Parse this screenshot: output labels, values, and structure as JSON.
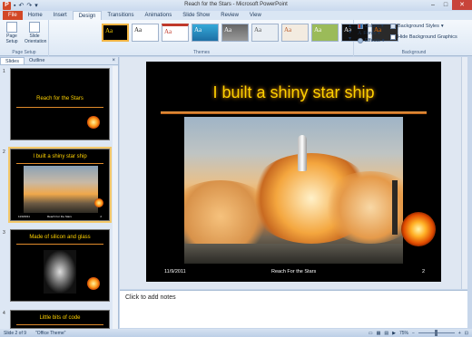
{
  "window": {
    "title": "Reach for the Stars - Microsoft PowerPoint"
  },
  "qat": {
    "save_icon": "save-icon",
    "undo_icon": "undo-icon",
    "redo_icon": "redo-icon"
  },
  "tabs": [
    "File",
    "Home",
    "Insert",
    "Design",
    "Transitions",
    "Animations",
    "Slide Show",
    "Review",
    "View"
  ],
  "active_tab": "Design",
  "ribbon": {
    "page_setup": {
      "page_setup_label": "Page Setup",
      "orientation_label": "Slide Orientation",
      "group_label": "Page Setup"
    },
    "themes": {
      "group_label": "Themes",
      "thumb_label": "Aa"
    },
    "theme_options": {
      "colors": "Colors",
      "fonts": "Fonts",
      "effects": "Effects"
    },
    "background": {
      "styles": "Background Styles",
      "hide": "Hide Background Graphics",
      "group_label": "Background"
    }
  },
  "panel": {
    "tabs": [
      "Slides",
      "Outline"
    ],
    "close": "×"
  },
  "slides": [
    {
      "num": "1",
      "title": "Reach for the Stars"
    },
    {
      "num": "2",
      "title": "I built a shiny star ship",
      "date": "11/9/2011",
      "footer": "Reach For the Stars",
      "page": "2"
    },
    {
      "num": "3",
      "title": "Made of silicon and glass"
    },
    {
      "num": "4",
      "title": "Little bits of code"
    }
  ],
  "main_slide": {
    "title": "I built a shiny star ship",
    "date": "11/9/2011",
    "footer": "Reach For the Stars",
    "page": "2"
  },
  "notes": {
    "placeholder": "Click to add notes"
  },
  "status": {
    "slide": "Slide 2 of 9",
    "theme": "\"Office Theme\"",
    "zoom": "75%"
  },
  "colors": {
    "file_tab": "#d24726",
    "title_yellow": "#ffd200",
    "accent_orange": "#e08a2b"
  }
}
